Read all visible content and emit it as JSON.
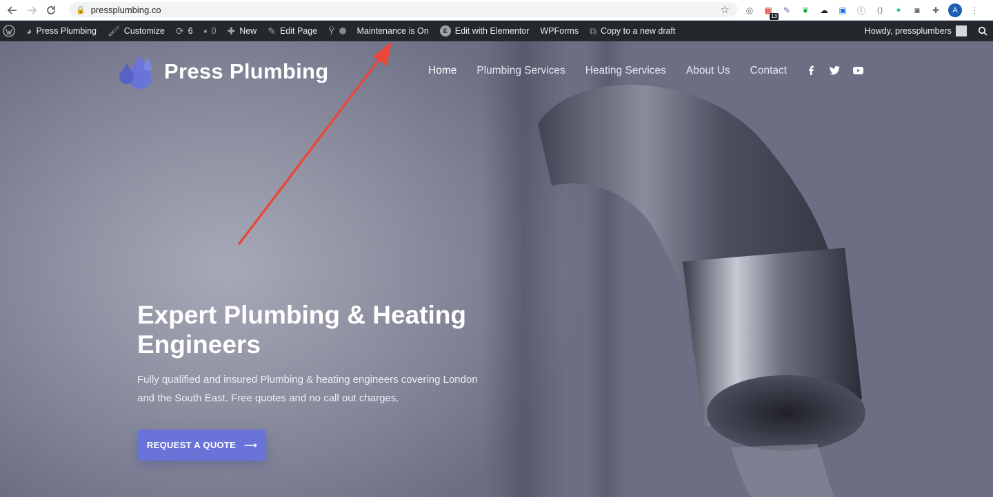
{
  "browser": {
    "url": "pressplumbing.co",
    "extension_badge": "13",
    "profile_initial": "A"
  },
  "adminbar": {
    "site_name": "Press Plumbing",
    "customize": "Customize",
    "updates_count": "6",
    "comments_count": "0",
    "new": "New",
    "edit_page": "Edit Page",
    "maintenance": "Maintenance is On",
    "edit_elementor": "Edit with Elementor",
    "wpforms": "WPForms",
    "copy_draft": "Copy to a new draft",
    "howdy": "Howdy, pressplumbers"
  },
  "site": {
    "logo_text": "Press Plumbing",
    "menu": [
      "Home",
      "Plumbing Services",
      "Heating Services",
      "About Us",
      "Contact"
    ],
    "socials": [
      "facebook-icon",
      "twitter-icon",
      "youtube-icon"
    ]
  },
  "hero": {
    "headline": "Expert Plumbing & Heating Engineers",
    "subtext": "Fully qualified and insured Plumbing & heating engineers covering London and the South East. Free quotes and no call out charges.",
    "cta_label": "REQUEST A QUOTE",
    "cta_arrow": "⟶"
  },
  "colors": {
    "accent": "#6a74d8",
    "admin_bar": "#23282d",
    "annotation_arrow": "#e8473a"
  }
}
